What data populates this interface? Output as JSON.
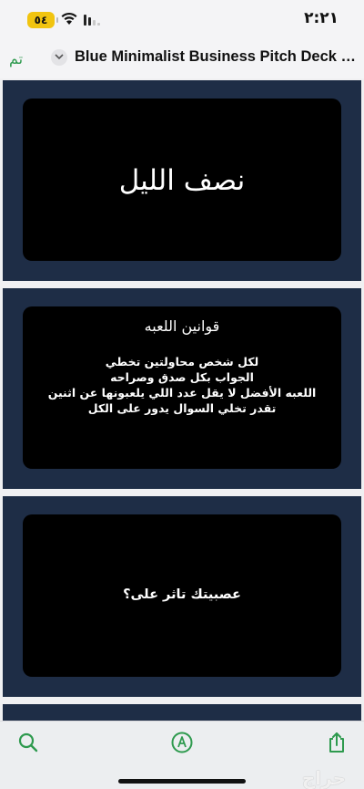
{
  "status_bar": {
    "time": "٢:٢١",
    "battery": "٥٤"
  },
  "nav": {
    "done_label": "تم",
    "title": "Blue Minimalist Business Pitch Deck Pr..."
  },
  "slides": [
    {
      "title": "نصف الليل"
    },
    {
      "title": "قوانين اللعبه",
      "lines": [
        "لكل شخص محاولتين تخطي",
        "الجواب بكل صدق وصراحه",
        "اللعبه الأفضل لا يقل عدد اللي يلعبونها عن اثنين",
        "تقدر تخلي السوال يدور على الكل"
      ]
    },
    {
      "title": "عصبيتك تاثر على؟"
    }
  ],
  "toolbar": {
    "watermark": "حراج"
  },
  "colors": {
    "accent": "#2e9a4e",
    "slide_border": "#1e2d46",
    "slide_bg": "#000000",
    "battery": "#f1c40f"
  }
}
